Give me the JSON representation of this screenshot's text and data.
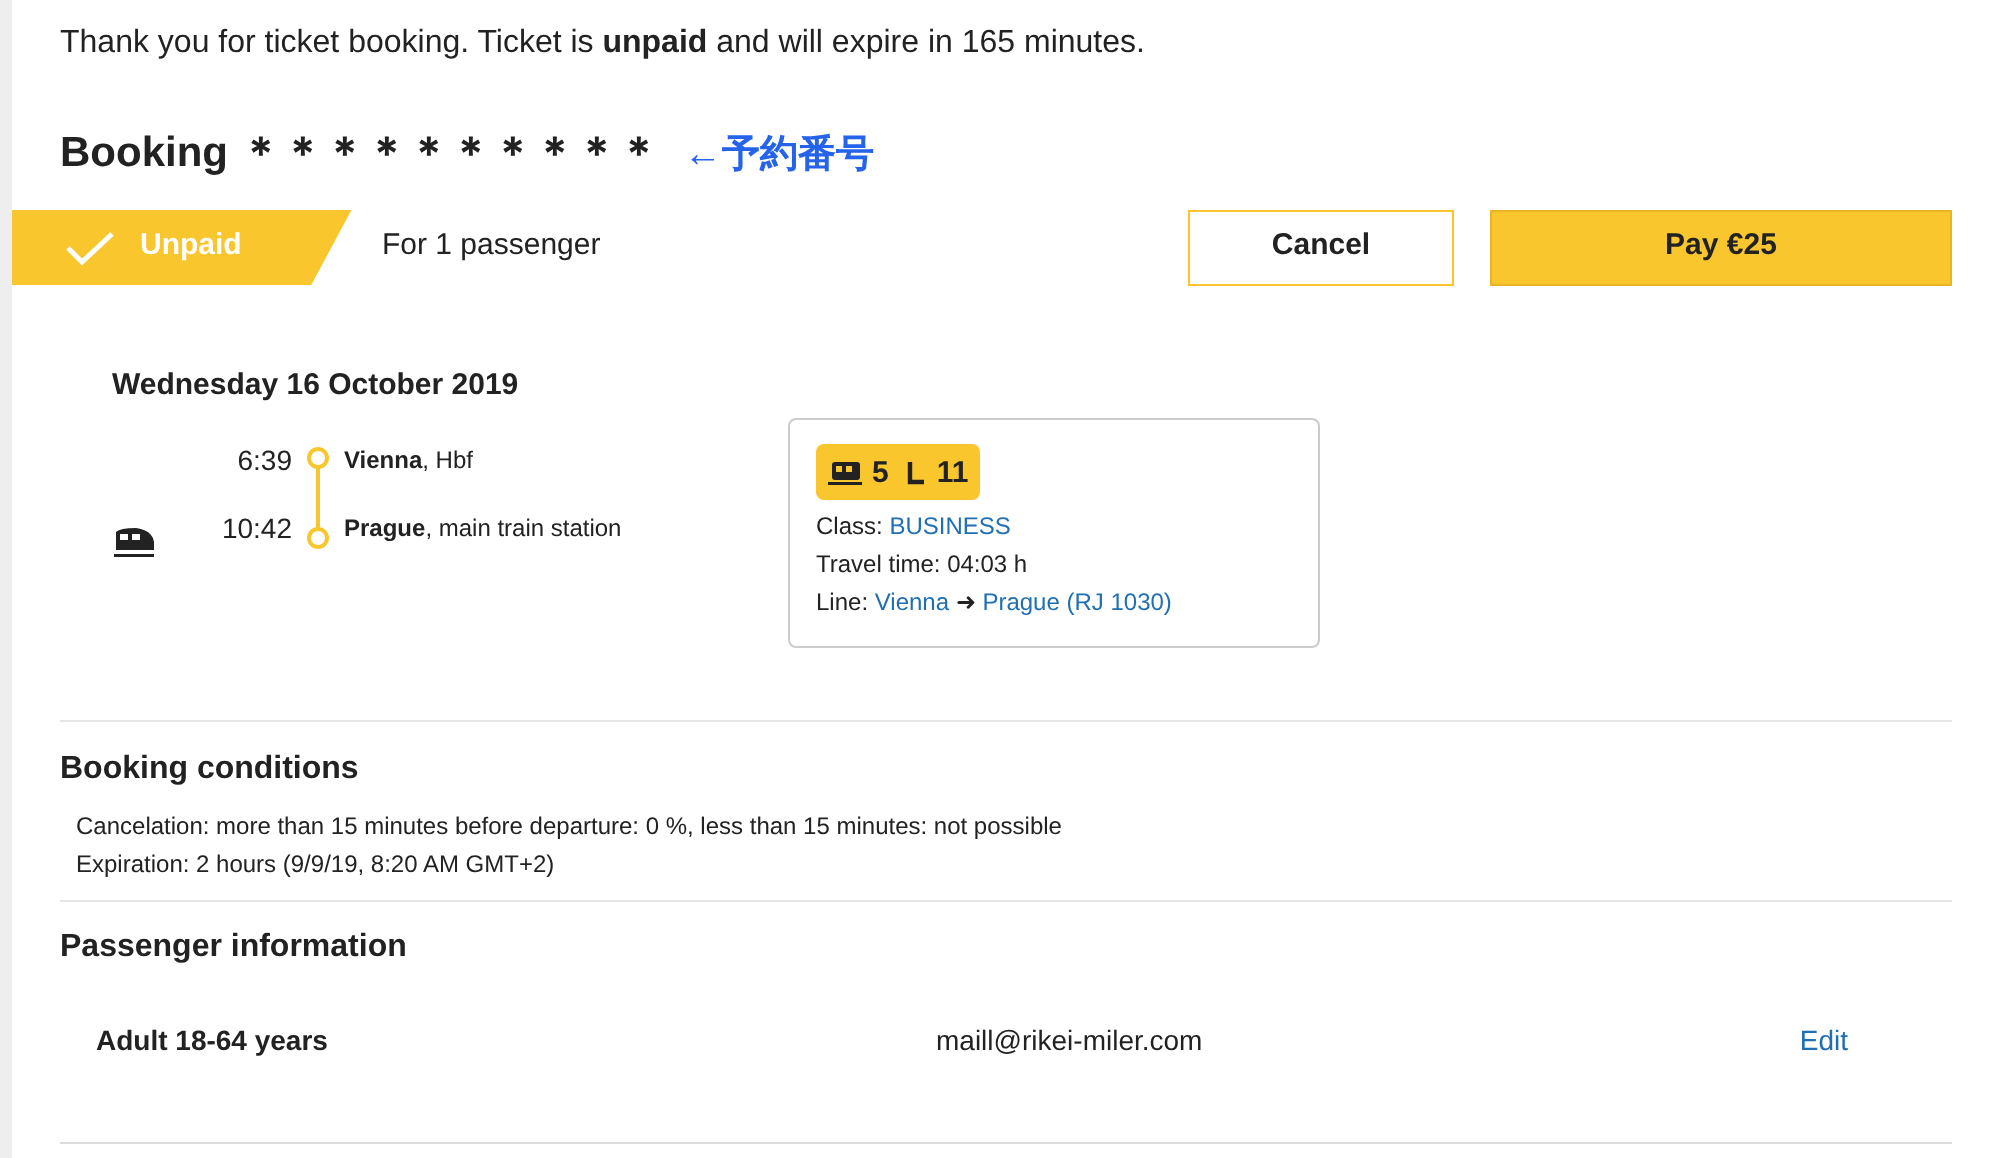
{
  "notice": "Thank you for ticket booking. Ticket is **unpaid** and will expire in 165 minutes.",
  "booking": {
    "title": "Booking ＊＊＊＊＊＊＊＊＊＊",
    "annotation": "←予約番号"
  },
  "status": {
    "label": "Unpaid",
    "passengers": "For 1 passenger"
  },
  "buttons": [
    {
      "label": "Cancel",
      "kind": "secondary"
    },
    {
      "label": "Pay €25",
      "kind": "primary"
    }
  ],
  "trip": {
    "date": "Wednesday 16 October 2019",
    "stops": [
      {
        "time": "6:39",
        "city": "Vienna",
        "station": ", Hbf"
      },
      {
        "time": "10:42",
        "city": "Prague",
        "station": ", main train station"
      }
    ],
    "seat": {
      "wagon": "5",
      "seat": "11"
    },
    "class_label": "Class: ",
    "class_value": "BUSINESS",
    "travel_time": "Travel time: 04:03 h",
    "line_label": "Line: ",
    "line_from": "Vienna",
    "line_arrow": "➜",
    "line_to": "Prague (RJ 1030)"
  },
  "conditions": {
    "title": "Booking conditions",
    "lines": [
      "Cancelation: more than 15 minutes before departure: 0 %, less than 15 minutes: not possible",
      "Expiration: 2 hours (9/9/19, 8:20 AM GMT+2)"
    ]
  },
  "passenger_info": {
    "title": "Passenger information",
    "rows": [
      {
        "type": "Adult 18-64 years",
        "email": "maill@rikei-miler.com",
        "action": "Edit"
      }
    ]
  }
}
